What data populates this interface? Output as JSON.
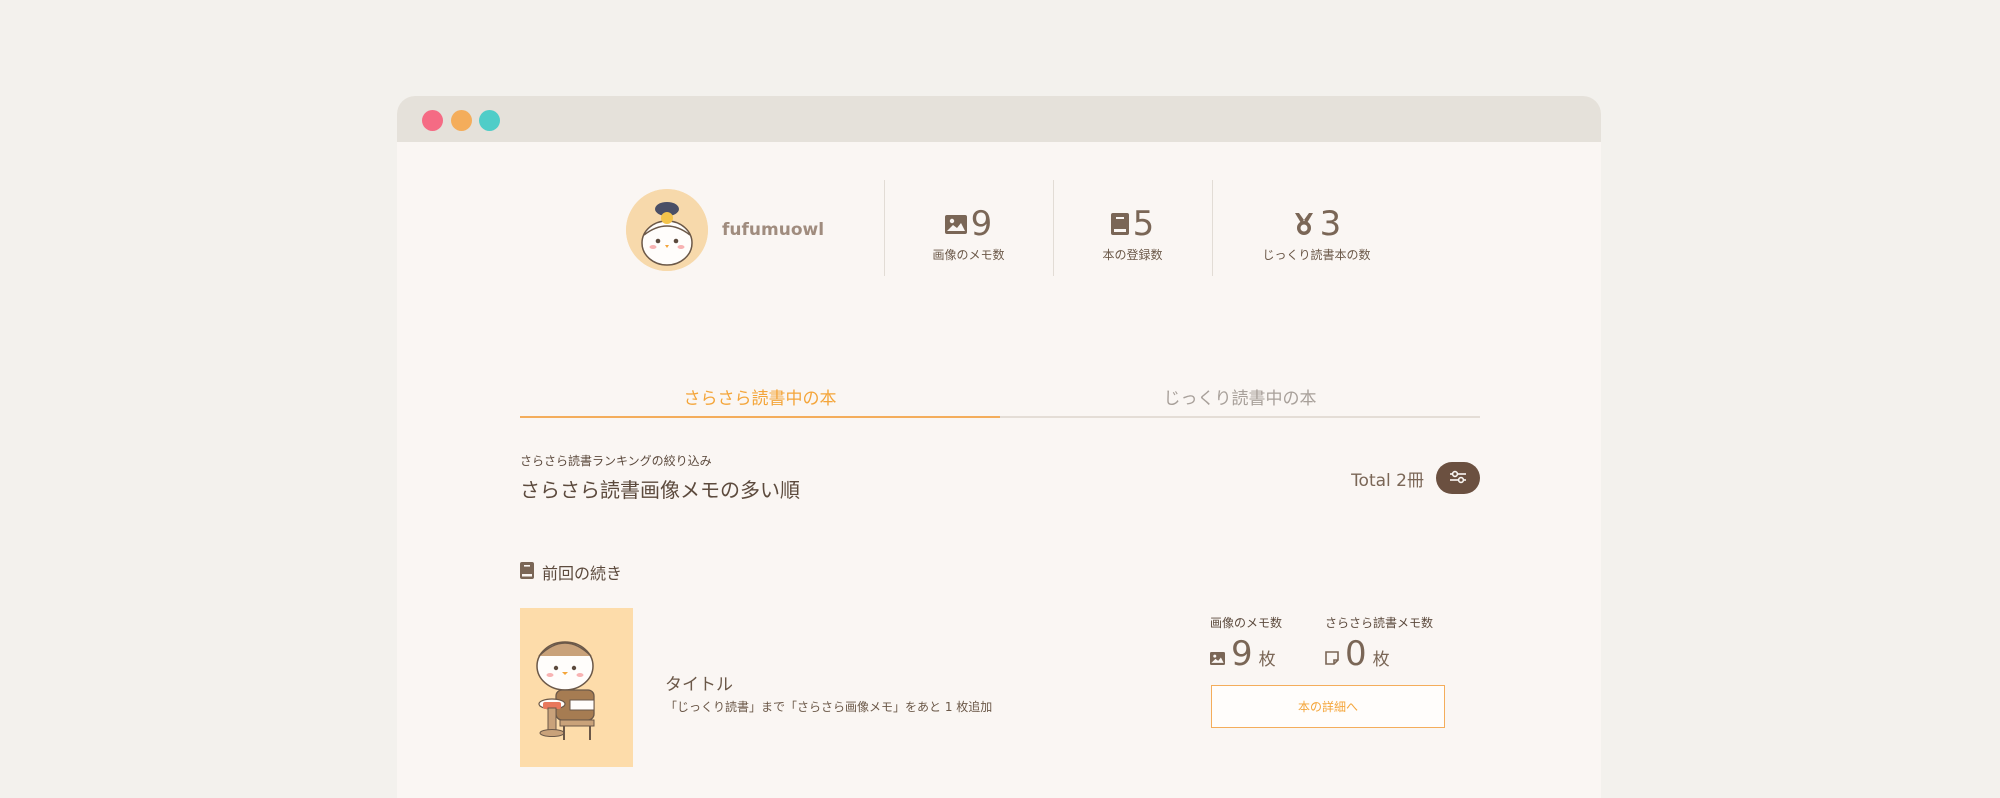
{
  "window_controls": [
    "close",
    "minimize",
    "zoom"
  ],
  "profile": {
    "username": "fufumuowl",
    "avatar_icon": "owl-avatar-icon"
  },
  "stats": [
    {
      "icon": "image-icon",
      "value": "9",
      "label": "画像のメモ数"
    },
    {
      "icon": "book-icon",
      "value": "5",
      "label": "本の登録数"
    },
    {
      "icon": "medal-icon",
      "value": "3",
      "label": "じっくり読書本の数"
    }
  ],
  "tabs": [
    {
      "label": "さらさら読書中の本",
      "active": true
    },
    {
      "label": "じっくり読書中の本",
      "active": false
    }
  ],
  "filter": {
    "subtitle": "さらさら読書ランキングの絞り込み",
    "title": "さらさら読書画像メモの多い順",
    "total": "Total 2冊",
    "button_icon": "sliders-icon"
  },
  "section": {
    "title": "前回の続き",
    "icon": "book-icon"
  },
  "book": {
    "title": "タイトル",
    "description": "「じっくり読書」まで「さらさら画像メモ」をあと 1 枚追加",
    "image_memo": {
      "label": "画像のメモ数",
      "value": "9",
      "unit": "枚"
    },
    "sarasara_memo": {
      "label": "さらさら読書メモ数",
      "value": "0",
      "unit": "枚"
    },
    "detail_button": "本の詳細へ"
  },
  "colors": {
    "accent": "#f4ad5b",
    "brown": "#6b5040",
    "text": "#6b5848"
  }
}
